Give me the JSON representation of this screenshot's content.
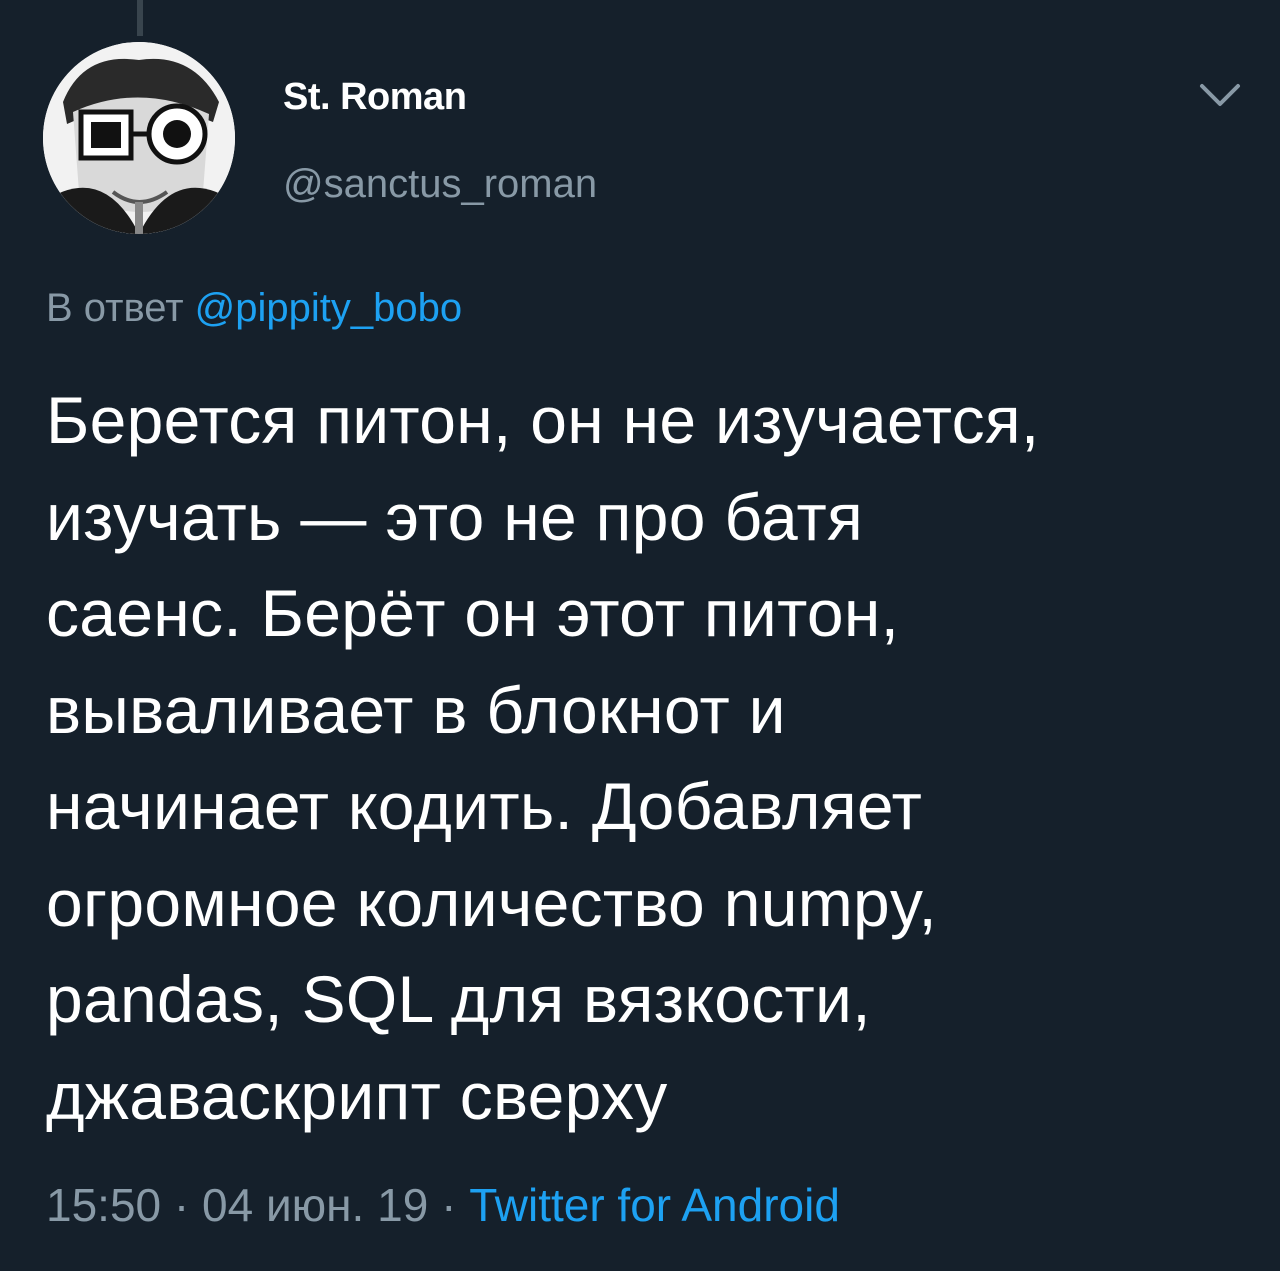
{
  "tweet": {
    "author": {
      "display_name": "St. Roman",
      "handle": "@sanctus_roman",
      "avatar": "avatar-photo"
    },
    "reply": {
      "prefix": "В ответ",
      "target": "@pippity_bobo"
    },
    "text": "Берется питон, он не изучается,\nизучать — это не про батя\nсаенс. Берёт он этот питон,\nвываливает в блокнот и\nначинает кодить. Добавляет\nогромное количество numpy,\npandas, SQL для вязкости,\nджаваскрипт сверху",
    "meta": {
      "time": "15:50",
      "separator": "·",
      "date": "04 июн. 19",
      "source": "Twitter for Android"
    },
    "menu_icon": "chevron-down-icon"
  },
  "colors": {
    "background": "#15202b",
    "primary_text": "#ffffff",
    "secondary_text": "#8899a6",
    "accent": "#1da1f2"
  }
}
